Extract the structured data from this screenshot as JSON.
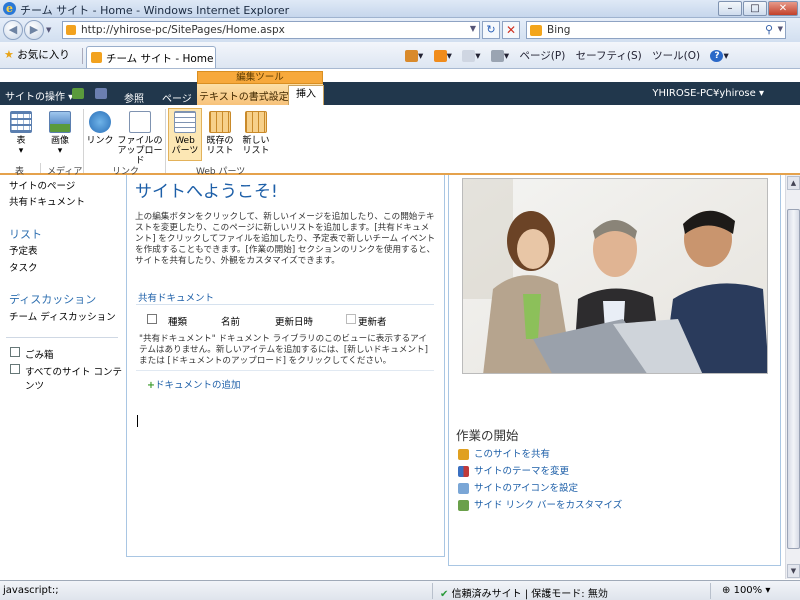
{
  "window": {
    "title": "チーム サイト - Home - Windows Internet Explorer",
    "minimize": "–",
    "maximize": "□",
    "close": "✕"
  },
  "addressbar": {
    "back": "◀",
    "forward": "▶",
    "dropdown": "▼",
    "url": "http://yhirose-pc/SitePages/Home.aspx",
    "refresh": "↻",
    "stop": "✕",
    "search_label": "Bing",
    "search_icon": "⚲"
  },
  "favorites": {
    "label": "お気に入り",
    "tab_title": "チーム サイト - Home"
  },
  "commandbar": {
    "page": "ページ(P)",
    "safety": "セーフティ(S)",
    "tools": "ツール(O)",
    "help": "?"
  },
  "sharepoint": {
    "site_actions": "サイトの操作 ▾",
    "browse": "参照",
    "page": "ページ",
    "context_group": "編集ツール",
    "tab_format": "テキストの書式設定",
    "tab_insert": "挿入",
    "user": "YHIROSE-PC¥yhirose ▾"
  },
  "ribbon": {
    "table": "表",
    "image": "画像",
    "link": "リンク",
    "upload_1": "ファイルの",
    "upload_2": "アップロード",
    "webpart_1": "Web",
    "webpart_2": "パーツ",
    "existing_1": "既存の",
    "existing_2": "リスト",
    "new_1": "新しい",
    "new_2": "リスト",
    "groups": {
      "table": "表",
      "media": "メディア",
      "links": "リンク",
      "webparts": "Web パーツ"
    }
  },
  "leftnav": {
    "site_pages": "サイトのページ",
    "shared_docs": "共有ドキュメント",
    "lists_heading": "リスト",
    "calendar": "予定表",
    "tasks": "タスク",
    "discussions_heading": "ディスカッション",
    "team_discussion": "チーム ディスカッション",
    "recycle_bin": "ごみ箱",
    "all_content": "すべてのサイト コンテンツ"
  },
  "main": {
    "welcome": "サイトへようこそ!",
    "intro": "上の編集ボタンをクリックして、新しいイメージを追加したり、この開始テキストを変更したり、このページに新しいリストを追加します。[共有ドキュメント] をクリックしてファイルを追加したり、予定表で新しいチーム イベントを作成することもできます。[作業の開始] セクションのリンクを使用すると、サイトを共有したり、外観をカスタマイズできます。",
    "doclib_title": "共有ドキュメント",
    "columns": {
      "type": "種類",
      "name": "名前",
      "modified": "更新日時",
      "modified_by": "更新者"
    },
    "empty_message": "\"共有ドキュメント\" ドキュメント ライブラリのこのビューに表示するアイテムはありません。新しいアイテムを追加するには、[新しいドキュメント] または [ドキュメントのアップロード] をクリックしてください。",
    "add_document": "ドキュメントの追加"
  },
  "getting_started": {
    "heading": "作業の開始",
    "links": [
      "このサイトを共有",
      "サイトのテーマを変更",
      "サイトのアイコンを設定",
      "サイド リンク バーをカスタマイズ"
    ]
  },
  "statusbar": {
    "text": "javascript:;",
    "zone": "信頼済みサイト | 保護モード: 無効",
    "zoom": "100%"
  }
}
